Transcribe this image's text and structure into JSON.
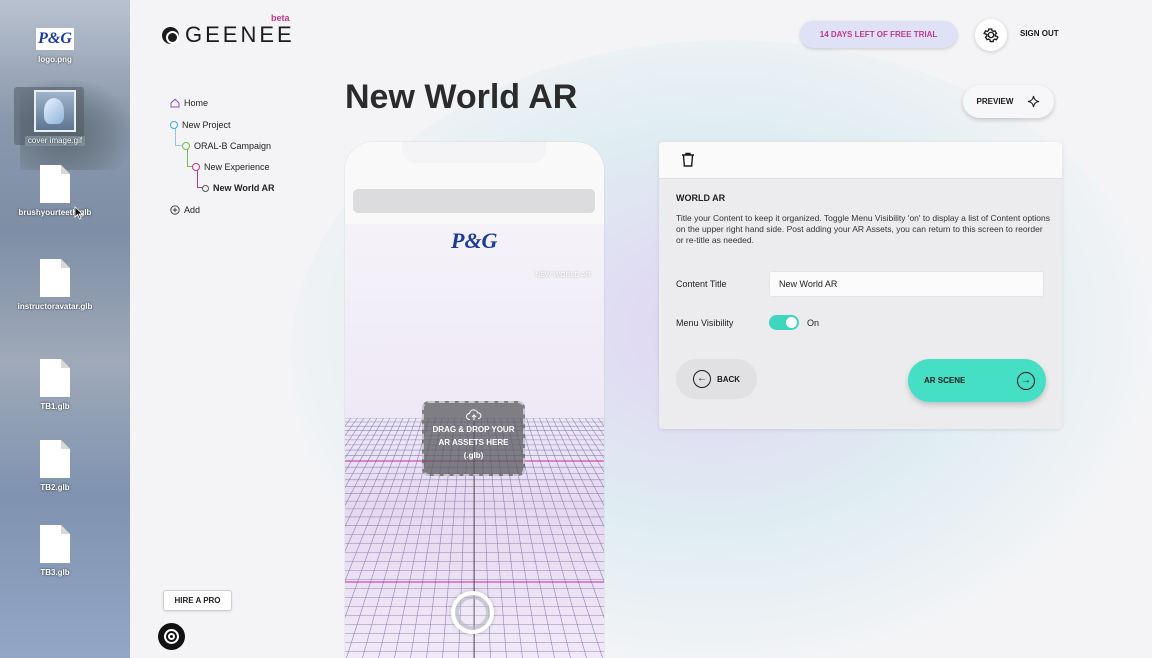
{
  "desktop": {
    "items": [
      {
        "label": "logo.png"
      },
      {
        "label": "cover image.gif"
      },
      {
        "label": "brushyourteeth.glb"
      },
      {
        "label": "instructoravatar.glb"
      },
      {
        "label": "TB1.glb"
      },
      {
        "label": "TB2.glb"
      },
      {
        "label": "TB3.glb"
      }
    ],
    "logo_text": "P&G"
  },
  "header": {
    "brand": "GEENEE",
    "beta": "beta",
    "trial": "14 DAYS LEFT OF FREE TRIAL",
    "sign_out": "SIGN OUT"
  },
  "nav": {
    "items": [
      {
        "label": "Home"
      },
      {
        "label": "New Project"
      },
      {
        "label": "ORAL-B Campaign"
      },
      {
        "label": "New Experience"
      },
      {
        "label": "New World AR"
      },
      {
        "label": "Add"
      }
    ],
    "colors": {
      "home": "#8b4fc9",
      "project": "#3aa7d8",
      "campaign": "#6bc24a",
      "experience": "#c0398a"
    }
  },
  "page": {
    "title": "New World AR",
    "preview": "PREVIEW"
  },
  "phone": {
    "logo": "P&G",
    "menu_label": "NEW WORLD AR",
    "dropzone": "DRAG & DROP YOUR AR ASSETS HERE (.glb)"
  },
  "panel": {
    "heading": "WORLD AR",
    "description": "Title your Content to keep it organized. Toggle Menu Visibility 'on' to display a list of Content options on the upper right hand side. Post adding your AR Assets, you can return to this screen to reorder or re-title as needed.",
    "content_title_label": "Content Title",
    "content_title_value": "New World AR",
    "menu_visibility_label": "Menu Visibility",
    "menu_visibility_state": "On",
    "back": "BACK",
    "next": "AR SCENE"
  },
  "footer": {
    "hire": "HIRE A PRO"
  },
  "colors": {
    "accent": "#44dfc5",
    "brand_pink": "#c0398a",
    "pg_blue": "#1a3b9a"
  }
}
